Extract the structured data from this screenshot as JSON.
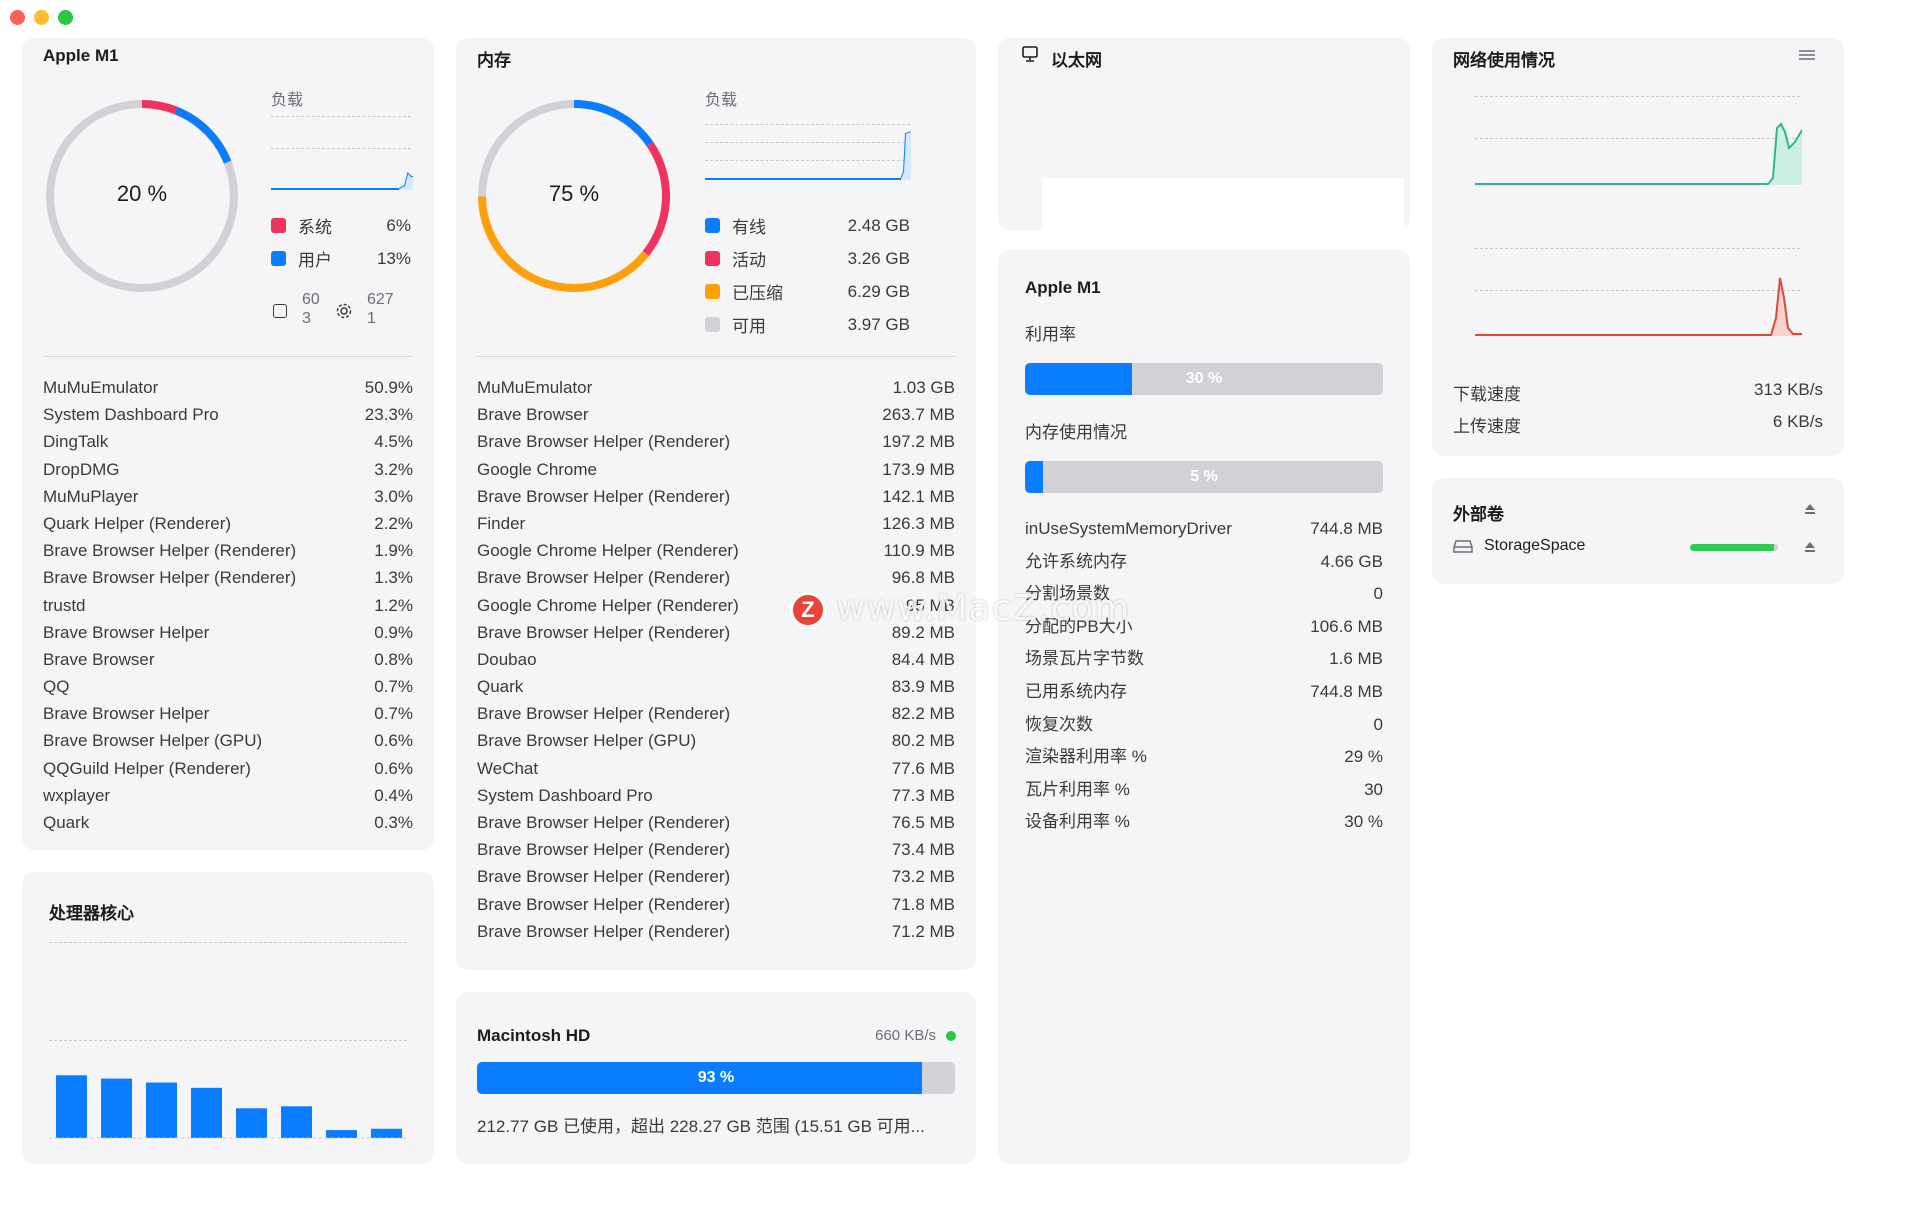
{
  "cpu": {
    "title": "Apple M1",
    "ring_percent": "20 %",
    "load_label": "负载",
    "legend": [
      {
        "label": "系统",
        "value": "6%",
        "color": "#f0335e"
      },
      {
        "label": "用户",
        "value": "13%",
        "color": "#0a7cff"
      }
    ],
    "threads": "60\n3",
    "processes_count": "627\n1",
    "processes": [
      {
        "name": "MuMuEmulator",
        "value": "50.9%"
      },
      {
        "name": "System Dashboard Pro",
        "value": "23.3%"
      },
      {
        "name": "DingTalk",
        "value": "4.5%"
      },
      {
        "name": "DropDMG",
        "value": "3.2%"
      },
      {
        "name": "MuMuPlayer",
        "value": "3.0%"
      },
      {
        "name": "Quark Helper (Renderer)",
        "value": "2.2%"
      },
      {
        "name": "Brave Browser Helper (Renderer)",
        "value": "1.9%"
      },
      {
        "name": "Brave Browser Helper (Renderer)",
        "value": "1.3%"
      },
      {
        "name": "trustd",
        "value": "1.2%"
      },
      {
        "name": "Brave Browser Helper",
        "value": "0.9%"
      },
      {
        "name": "Brave Browser",
        "value": "0.8%"
      },
      {
        "name": "QQ",
        "value": "0.7%"
      },
      {
        "name": "Brave Browser Helper",
        "value": "0.7%"
      },
      {
        "name": "Brave Browser Helper (GPU)",
        "value": "0.6%"
      },
      {
        "name": "QQGuild Helper (Renderer)",
        "value": "0.6%"
      },
      {
        "name": "wxplayer",
        "value": "0.4%"
      },
      {
        "name": "Quark",
        "value": "0.3%"
      }
    ]
  },
  "cores": {
    "title": "处理器核心",
    "values": [
      0.95,
      0.9,
      0.84,
      0.76,
      0.45,
      0.48,
      0.12,
      0.14
    ]
  },
  "memory": {
    "title": "内存",
    "ring_percent": "75 %",
    "load_label": "负载",
    "legend": [
      {
        "label": "有线",
        "value": "2.48 GB",
        "color": "#0a7cff"
      },
      {
        "label": "活动",
        "value": "3.26 GB",
        "color": "#f0335e"
      },
      {
        "label": "已压缩",
        "value": "6.29 GB",
        "color": "#ff9f0a"
      },
      {
        "label": "可用",
        "value": "3.97 GB",
        "color": "#d1d1d6"
      }
    ],
    "processes": [
      {
        "name": "MuMuEmulator",
        "value": "1.03 GB"
      },
      {
        "name": "Brave Browser",
        "value": "263.7 MB"
      },
      {
        "name": "Brave Browser Helper (Renderer)",
        "value": "197.2 MB"
      },
      {
        "name": "Google Chrome",
        "value": "173.9 MB"
      },
      {
        "name": "Brave Browser Helper (Renderer)",
        "value": "142.1 MB"
      },
      {
        "name": "Finder",
        "value": "126.3 MB"
      },
      {
        "name": "Google Chrome Helper (Renderer)",
        "value": "110.9 MB"
      },
      {
        "name": "Brave Browser Helper (Renderer)",
        "value": "96.8 MB"
      },
      {
        "name": "Google Chrome Helper (Renderer)",
        "value": "95 MB"
      },
      {
        "name": "Brave Browser Helper (Renderer)",
        "value": "89.2 MB"
      },
      {
        "name": "Doubao",
        "value": "84.4 MB"
      },
      {
        "name": "Quark",
        "value": "83.9 MB"
      },
      {
        "name": "Brave Browser Helper (Renderer)",
        "value": "82.2 MB"
      },
      {
        "name": "Brave Browser Helper (GPU)",
        "value": "80.2 MB"
      },
      {
        "name": "WeChat",
        "value": "77.6 MB"
      },
      {
        "name": "System Dashboard Pro",
        "value": "77.3 MB"
      },
      {
        "name": "Brave Browser Helper (Renderer)",
        "value": "76.5 MB"
      },
      {
        "name": "Brave Browser Helper (Renderer)",
        "value": "73.4 MB"
      },
      {
        "name": "Brave Browser Helper (Renderer)",
        "value": "73.2 MB"
      },
      {
        "name": "Brave Browser Helper (Renderer)",
        "value": "71.8 MB"
      },
      {
        "name": "Brave Browser Helper (Renderer)",
        "value": "71.2 MB"
      }
    ]
  },
  "disk": {
    "title": "Macintosh HD",
    "speed": "660 KB/s",
    "percent_label": "93 %",
    "percent": 0.93,
    "summary": "212.77 GB 已使用，超出 228.27 GB 范围 (15.51 GB 可用..."
  },
  "ethernet": {
    "title": "以太网"
  },
  "gpu": {
    "title": "Apple M1",
    "util_label": "利用率",
    "util_percent_label": "30 %",
    "util_percent": 0.3,
    "mem_label": "内存使用情况",
    "mem_percent_label": "5 %",
    "mem_percent": 0.05,
    "stats": [
      {
        "name": "inUseSystemMemoryDriver",
        "value": "744.8 MB"
      },
      {
        "name": "允许系统内存",
        "value": "4.66 GB"
      },
      {
        "name": "分割场景数",
        "value": "0"
      },
      {
        "name": "分配的PB大小",
        "value": "106.6 MB"
      },
      {
        "name": "场景瓦片字节数",
        "value": "1.6 MB"
      },
      {
        "name": "已用系统内存",
        "value": "744.8 MB"
      },
      {
        "name": "恢复次数",
        "value": "0"
      },
      {
        "name": "渲染器利用率 %",
        "value": "29 %"
      },
      {
        "name": "瓦片利用率 %",
        "value": "30"
      },
      {
        "name": "设备利用率 %",
        "value": "30 %"
      }
    ]
  },
  "network": {
    "title": "网络使用情况",
    "download_label": "下载速度",
    "download_value": "313 KB/s",
    "upload_label": "上传速度",
    "upload_value": "6 KB/s"
  },
  "volumes": {
    "title": "外部卷",
    "items": [
      {
        "name": "StorageSpace",
        "usage": 0.95
      }
    ]
  },
  "watermark": "www.MacZ.com",
  "watermark_logo": "Z"
}
